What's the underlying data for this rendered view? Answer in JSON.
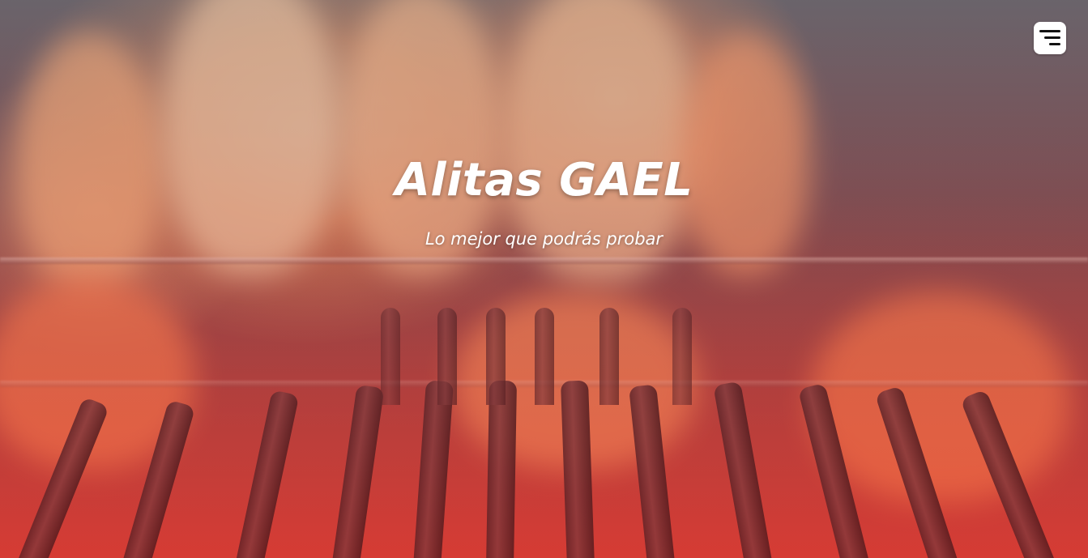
{
  "hero": {
    "title": "Alitas GAEL",
    "subtitle": "Lo mejor que podrás probar"
  },
  "nav": {
    "menu_icon": "hamburger-menu-icon"
  },
  "colors": {
    "text": "#ffffff",
    "menu_bg": "#ffffff",
    "menu_icon": "#111111",
    "flame": "#ff8c55",
    "tint_bottom": "#e2513f"
  }
}
